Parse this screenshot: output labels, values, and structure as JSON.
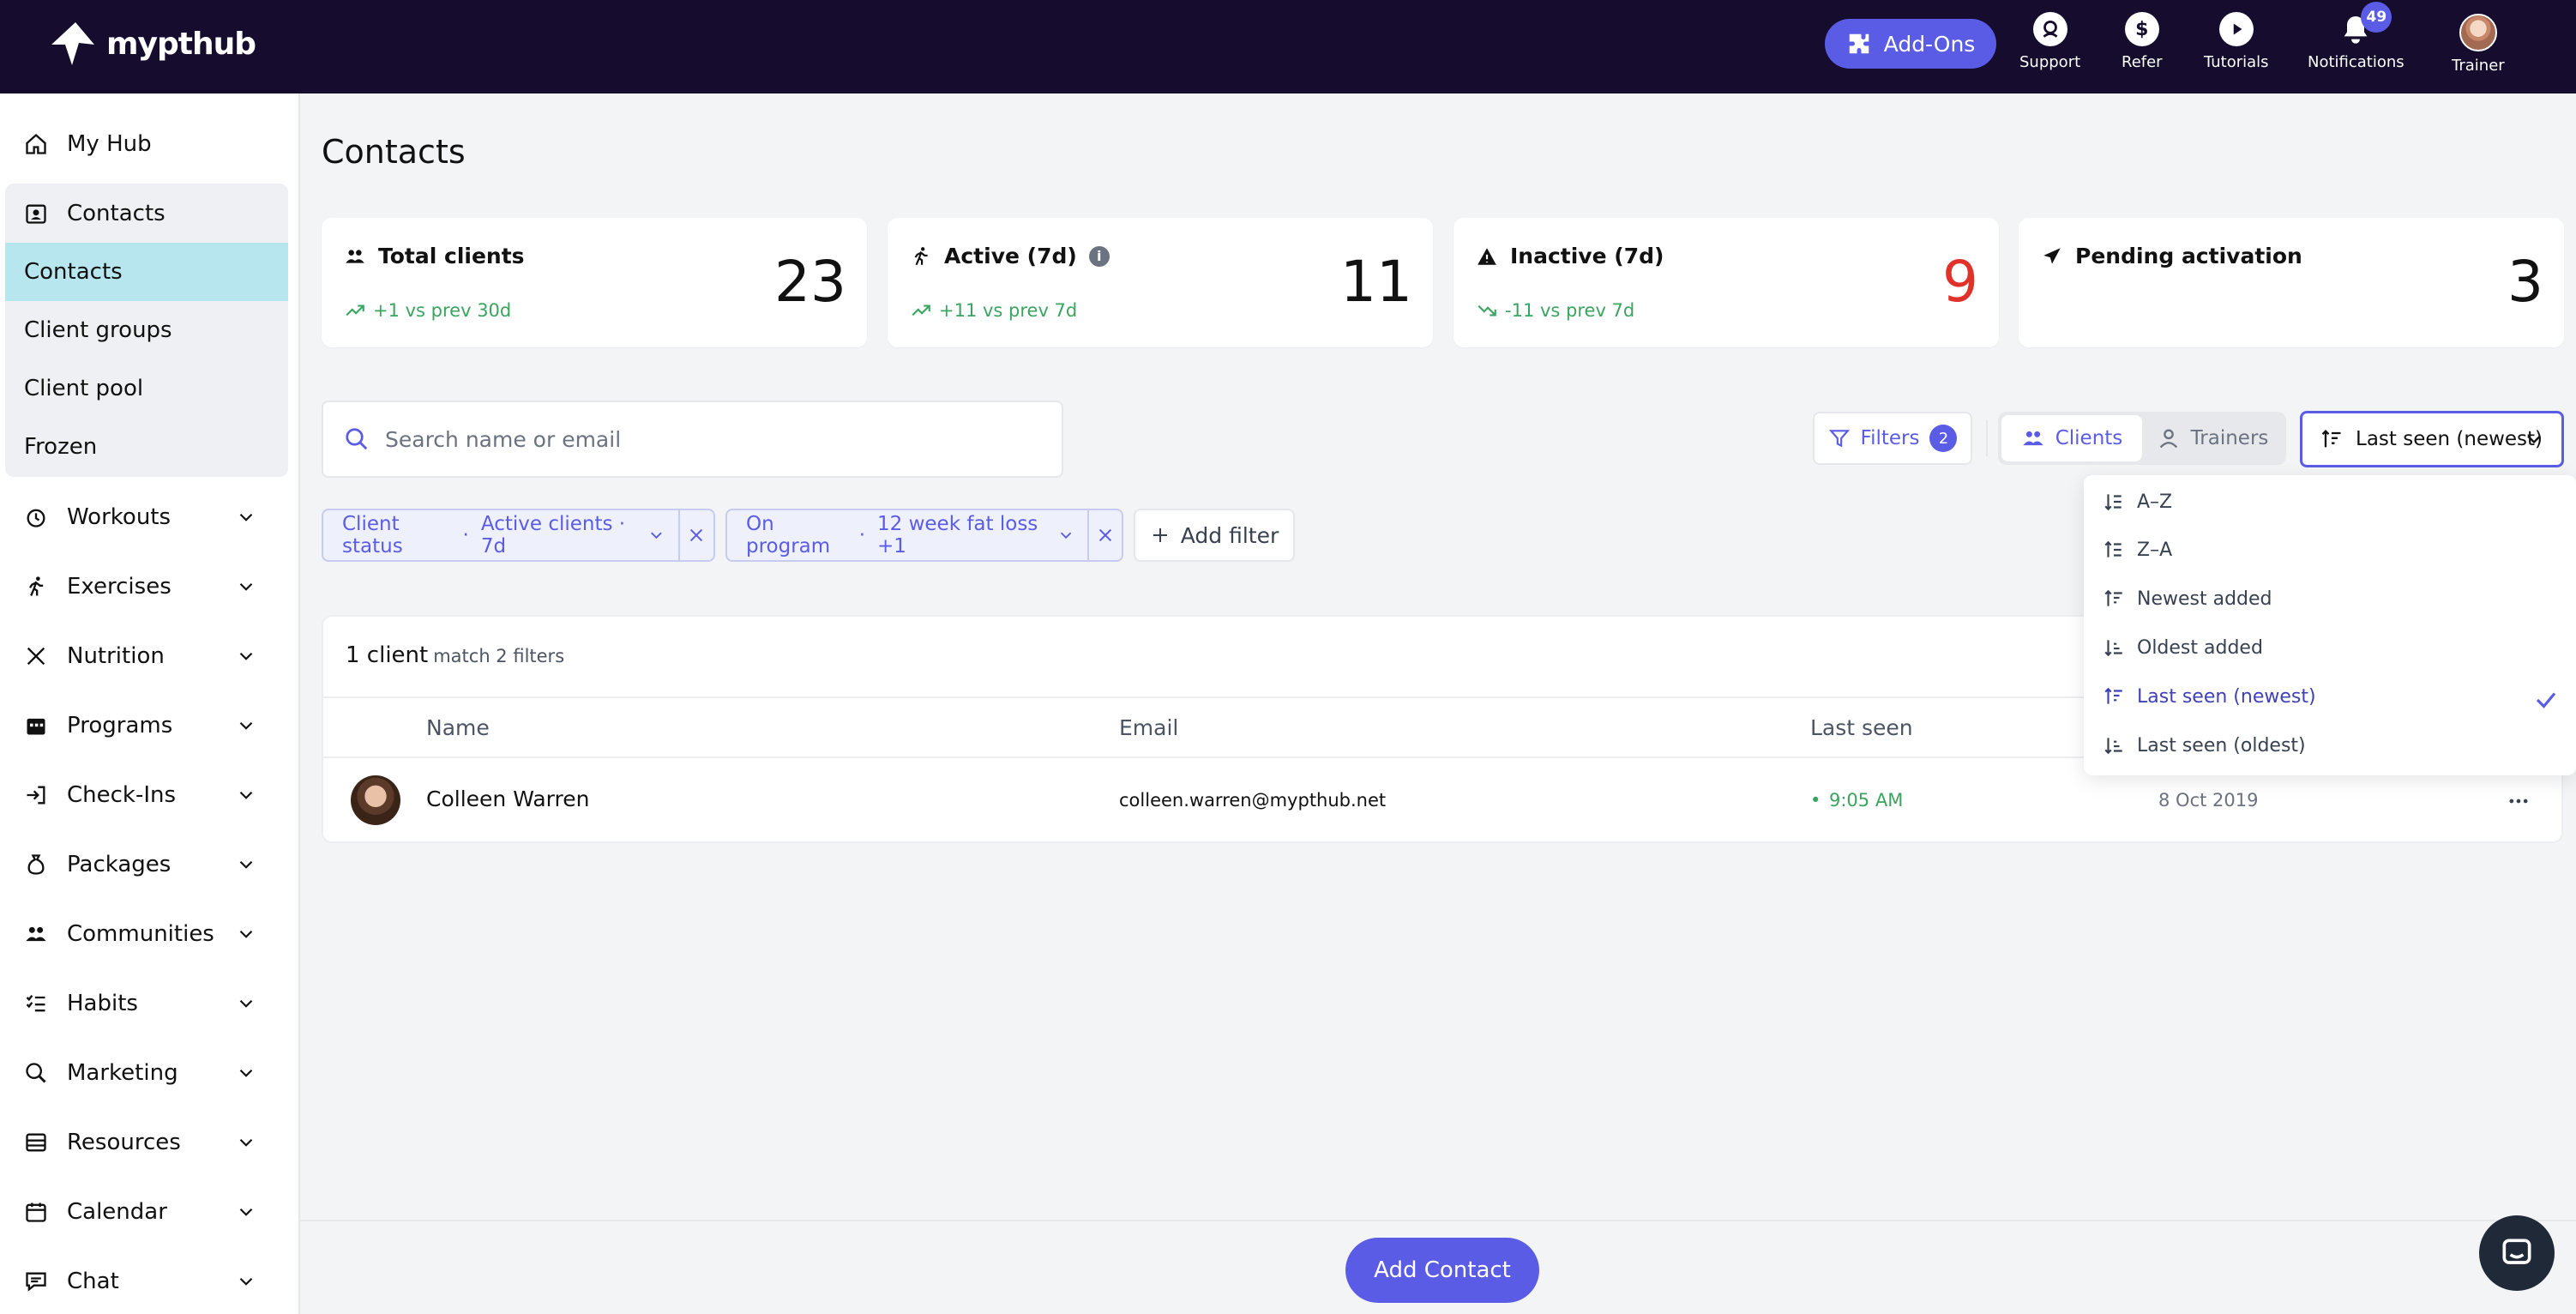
{
  "brand": {
    "name": "mypthub"
  },
  "topbar": {
    "addons_label": "Add-Ons",
    "nav": [
      {
        "label": "Support",
        "icon": "support-icon"
      },
      {
        "label": "Refer",
        "icon": "dollar-icon"
      },
      {
        "label": "Tutorials",
        "icon": "play-icon"
      },
      {
        "label": "Notifications",
        "icon": "bell-icon",
        "badge": "49"
      },
      {
        "label": "Trainer",
        "icon": "avatar"
      }
    ]
  },
  "sidebar": {
    "my_hub": "My Hub",
    "contacts_header": "Contacts",
    "sub_items": [
      "Contacts",
      "Client groups",
      "Client pool",
      "Frozen"
    ],
    "items": [
      {
        "label": "Workouts",
        "icon": "workout-icon"
      },
      {
        "label": "Exercises",
        "icon": "running-icon"
      },
      {
        "label": "Nutrition",
        "icon": "utensils-icon"
      },
      {
        "label": "Programs",
        "icon": "calendar-grid-icon"
      },
      {
        "label": "Check-Ins",
        "icon": "login-icon"
      },
      {
        "label": "Packages",
        "icon": "money-bag-icon"
      },
      {
        "label": "Communities",
        "icon": "people-icon"
      },
      {
        "label": "Habits",
        "icon": "checklist-icon"
      },
      {
        "label": "Marketing",
        "icon": "search-chart-icon"
      },
      {
        "label": "Resources",
        "icon": "folder-icon"
      },
      {
        "label": "Calendar",
        "icon": "calendar-icon"
      },
      {
        "label": "Chat",
        "icon": "chat-icon"
      }
    ]
  },
  "page": {
    "title": "Contacts"
  },
  "stats": [
    {
      "label": "Total clients",
      "sub": "+1 vs prev 30d",
      "value": "23",
      "value_color": "#111111"
    },
    {
      "label": "Active (7d)",
      "sub": "+11 vs prev 7d",
      "value": "11",
      "value_color": "#111111"
    },
    {
      "label": "Inactive (7d)",
      "sub": "-11 vs prev 7d",
      "value": "9",
      "value_color": "#e0312b"
    },
    {
      "label": "Pending activation",
      "sub": "",
      "value": "3",
      "value_color": "#111111"
    }
  ],
  "toolbar": {
    "search_placeholder": "Search name or email",
    "filters_label": "Filters",
    "filters_count": "2",
    "seg_clients": "Clients",
    "seg_trainers": "Trainers",
    "sort_label": "Last seen (newest)"
  },
  "chips": {
    "status": {
      "key": "Client status",
      "sep": "·",
      "value": "Active clients · 7d"
    },
    "program": {
      "key": "On program",
      "sep": "·",
      "value": "12 week fat loss +1"
    },
    "add_filter": "Add filter"
  },
  "results": {
    "count": "1 client",
    "suffix": "match 2 filters",
    "columns": [
      "Name",
      "Email",
      "Last seen"
    ],
    "rows": [
      {
        "name": "Colleen Warren",
        "email": "colleen.warren@mypthub.net",
        "last_seen": "9:05 AM",
        "date": "8 Oct 2019"
      }
    ]
  },
  "sort_menu": {
    "options": [
      "A–Z",
      "Z–A",
      "Newest added",
      "Oldest added",
      "Last seen (newest)",
      "Last seen (oldest)"
    ],
    "selected": "Last seen (newest)"
  },
  "footer": {
    "add_contact": "Add Contact"
  },
  "colors": {
    "brand_dark": "#150c2e",
    "accent": "#5b5ce6",
    "positive": "#3aa55f",
    "negative": "#e0312b",
    "active_nav": "#b7e6ef"
  }
}
